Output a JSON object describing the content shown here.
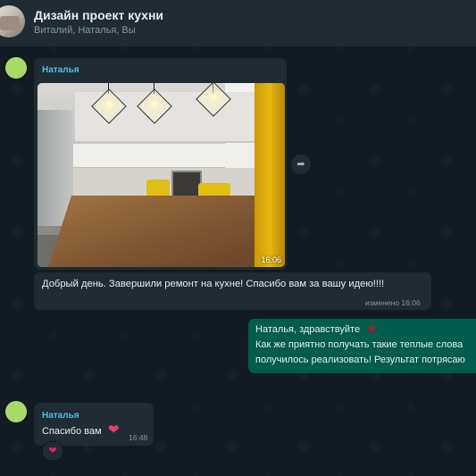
{
  "header": {
    "title": "Дизайн проект кухни",
    "subtitle": "Виталий, Наталья, Вы"
  },
  "messages": {
    "first": {
      "sender": "Наталья",
      "image_time": "16:06",
      "text": "Добрый день. Завершили ремонт на кухне! Спасибо вам за вашу идею!!!!",
      "meta": "изменено 16:06"
    },
    "outgoing": {
      "line1": "Наталья, здравствуйте ",
      "line2": "Как же приятно получать такие теплые слова",
      "line3": "получилось реализовать! Результат потрясаю"
    },
    "second": {
      "sender": "Наталья",
      "text": "Спасибо вам",
      "time": "16:48",
      "reaction": "❤"
    }
  },
  "icons": {
    "forward": "forward-icon",
    "heart": "red-heart-emoji",
    "rose": "rose-emoji"
  },
  "colors": {
    "background": "#111b21",
    "incoming_bubble": "#202c33",
    "outgoing_bubble": "#005c4b",
    "sender_name": "#53bdeb",
    "avatar": "#a6db6a"
  }
}
